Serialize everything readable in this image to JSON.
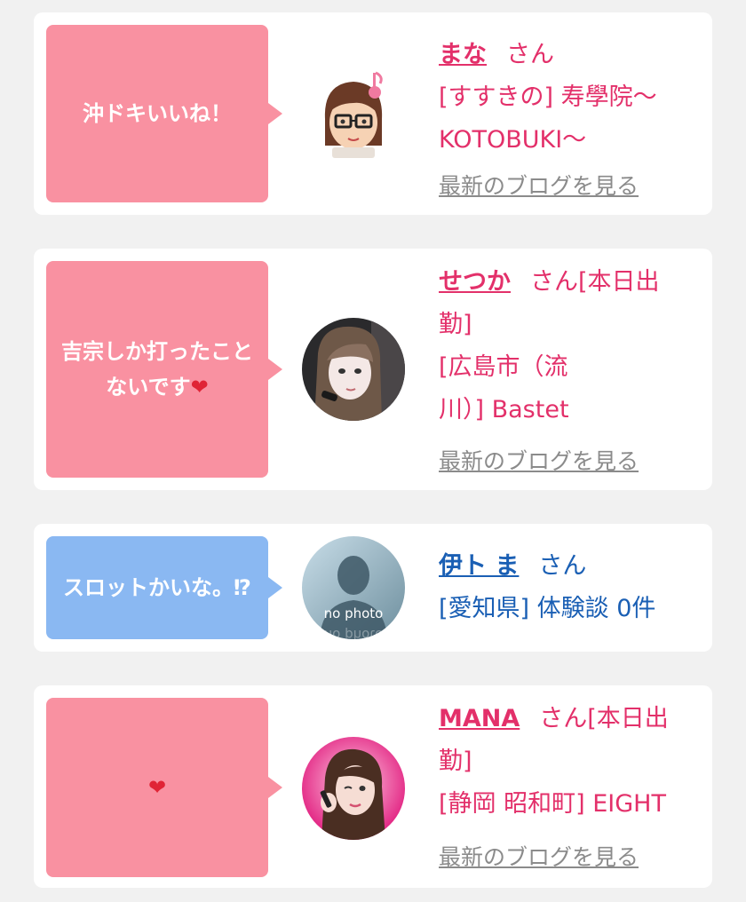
{
  "colors": {
    "pink_bubble": "#f991a1",
    "blue_bubble": "#8ab8f2",
    "pink_text": "#e3306a",
    "blue_text": "#1a5fb4",
    "link_gray": "#8b8b8b"
  },
  "cards": [
    {
      "comment": "沖ドキいいね！",
      "name": "まな",
      "san": "さん",
      "detail_line1": "[すすきの] 寿學院〜",
      "detail_line2": "KOTOBUKI〜",
      "blog_link": "最新のブログを見る",
      "avatar_icon": "cartoon-girl-glasses-icon"
    },
    {
      "comment": "吉宗しか打ったことないです",
      "comment_emoji": "❤",
      "name": "せつか",
      "san": "さん[本日出",
      "detail_line1": "勤]",
      "detail_line2": "[広島市（流",
      "detail_line3": "川）] Bastet",
      "blog_link": "最新のブログを見る",
      "avatar_icon": "profile-photo"
    },
    {
      "comment": "スロットかいな。⁉",
      "name": "伊ト ま",
      "san": "さん",
      "detail_line1": "[愛知県] 体験談 0件",
      "avatar_text": "no photo",
      "avatar_icon": "silhouette-icon"
    },
    {
      "comment_emoji": "❤",
      "name": "MANA",
      "san": "さん[本日出",
      "detail_line1": "勤]",
      "detail_line2": "[静岡 昭和町] EIGHT",
      "blog_link": "最新のブログを見る",
      "avatar_icon": "profile-photo"
    }
  ]
}
